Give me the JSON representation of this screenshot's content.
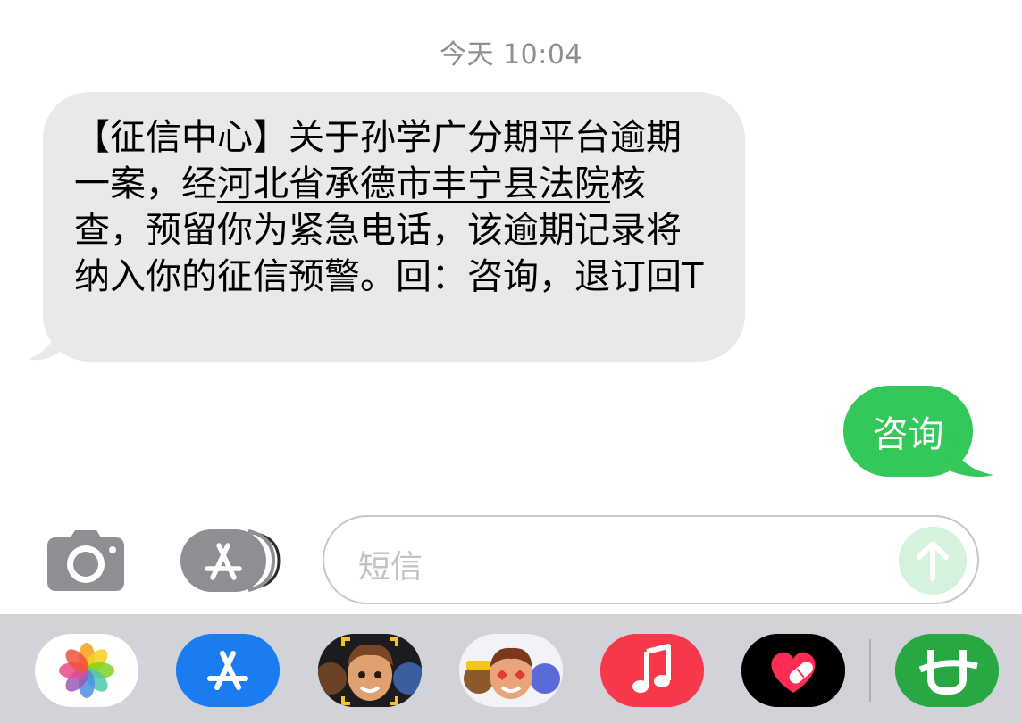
{
  "conversation": {
    "timestamp": "今天 10:04",
    "incoming": {
      "text_before": "【征信中心】关于孙学广分期平台逾期一案，经",
      "link_text": "河北省承德市丰宁县法院",
      "text_after": "核查，预留你为紧急电话，该逾期记录将纳入你的征信预警。回：咨询，退订回T"
    },
    "outgoing": {
      "text": "咨询"
    }
  },
  "composer": {
    "placeholder": "短信",
    "camera_icon": "camera-icon",
    "apps_icon": "app-store-icon",
    "send_icon": "arrow-up-icon"
  },
  "app_strip": {
    "apps": [
      "photos",
      "app-store",
      "memoji-stickers",
      "animoji",
      "music",
      "digital-touch",
      "third-party-app"
    ]
  },
  "colors": {
    "incoming_bubble": "#e9e9eb",
    "outgoing_bubble": "#34c759",
    "timestamp": "#8e8e93"
  }
}
